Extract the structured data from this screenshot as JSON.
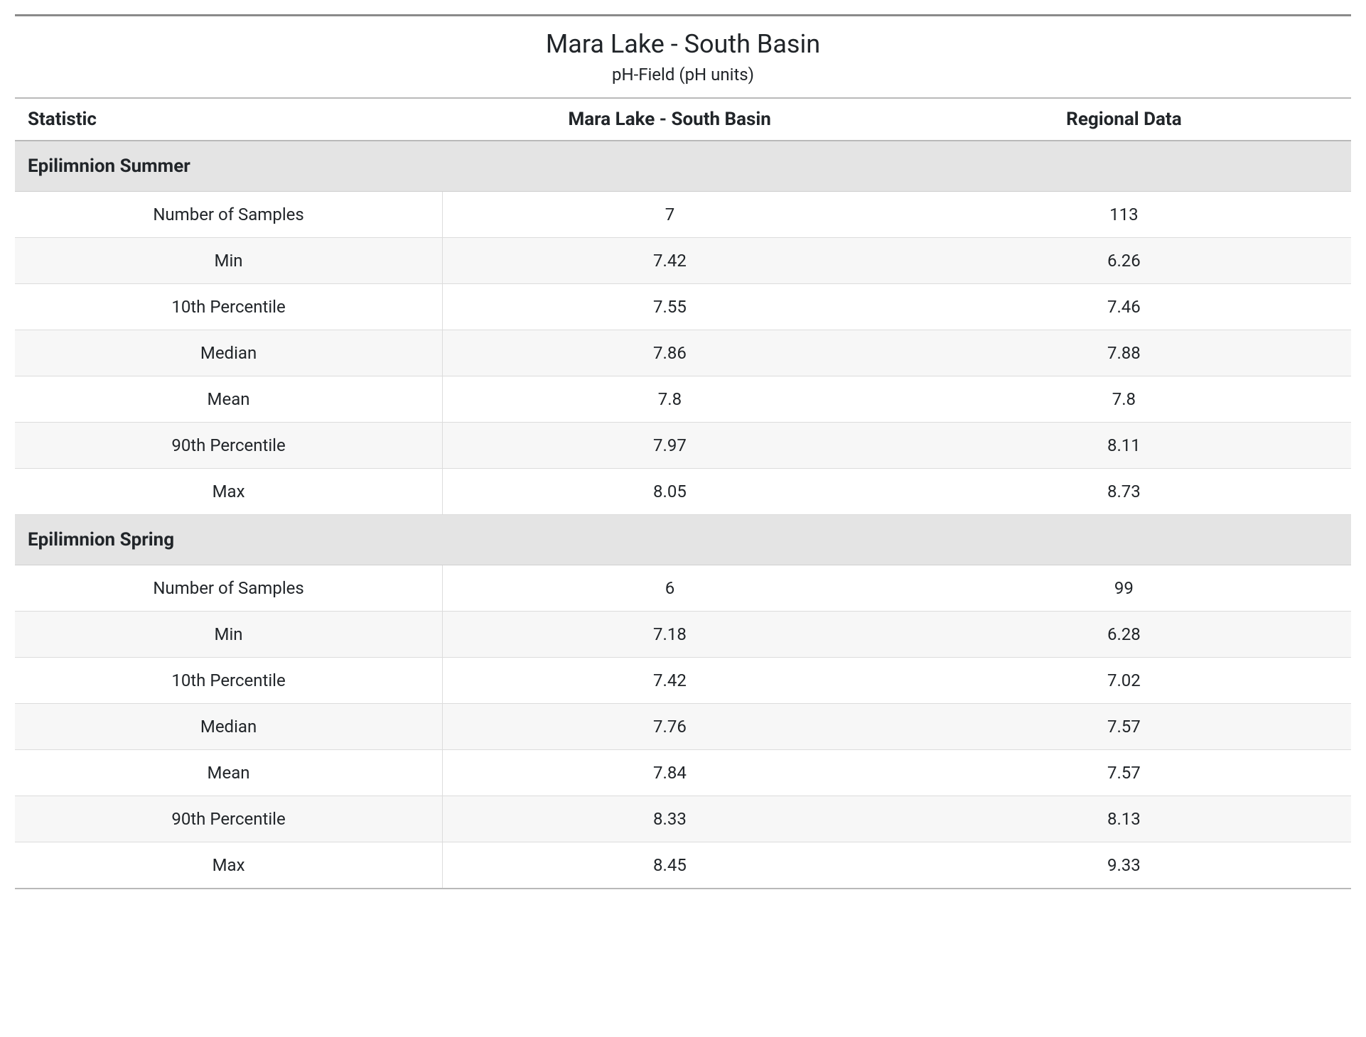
{
  "header": {
    "title": "Mara Lake - South Basin",
    "subtitle": "pH-Field (pH units)"
  },
  "columns": {
    "stat": "Statistic",
    "site": "Mara Lake - South Basin",
    "regional": "Regional Data"
  },
  "sections": [
    {
      "name": "Epilimnion Summer",
      "rows": [
        {
          "stat": "Number of Samples",
          "site": "7",
          "regional": "113"
        },
        {
          "stat": "Min",
          "site": "7.42",
          "regional": "6.26"
        },
        {
          "stat": "10th Percentile",
          "site": "7.55",
          "regional": "7.46"
        },
        {
          "stat": "Median",
          "site": "7.86",
          "regional": "7.88"
        },
        {
          "stat": "Mean",
          "site": "7.8",
          "regional": "7.8"
        },
        {
          "stat": "90th Percentile",
          "site": "7.97",
          "regional": "8.11"
        },
        {
          "stat": "Max",
          "site": "8.05",
          "regional": "8.73"
        }
      ]
    },
    {
      "name": "Epilimnion Spring",
      "rows": [
        {
          "stat": "Number of Samples",
          "site": "6",
          "regional": "99"
        },
        {
          "stat": "Min",
          "site": "7.18",
          "regional": "6.28"
        },
        {
          "stat": "10th Percentile",
          "site": "7.42",
          "regional": "7.02"
        },
        {
          "stat": "Median",
          "site": "7.76",
          "regional": "7.57"
        },
        {
          "stat": "Mean",
          "site": "7.84",
          "regional": "7.57"
        },
        {
          "stat": "90th Percentile",
          "site": "8.33",
          "regional": "8.13"
        },
        {
          "stat": "Max",
          "site": "8.45",
          "regional": "9.33"
        }
      ]
    }
  ]
}
